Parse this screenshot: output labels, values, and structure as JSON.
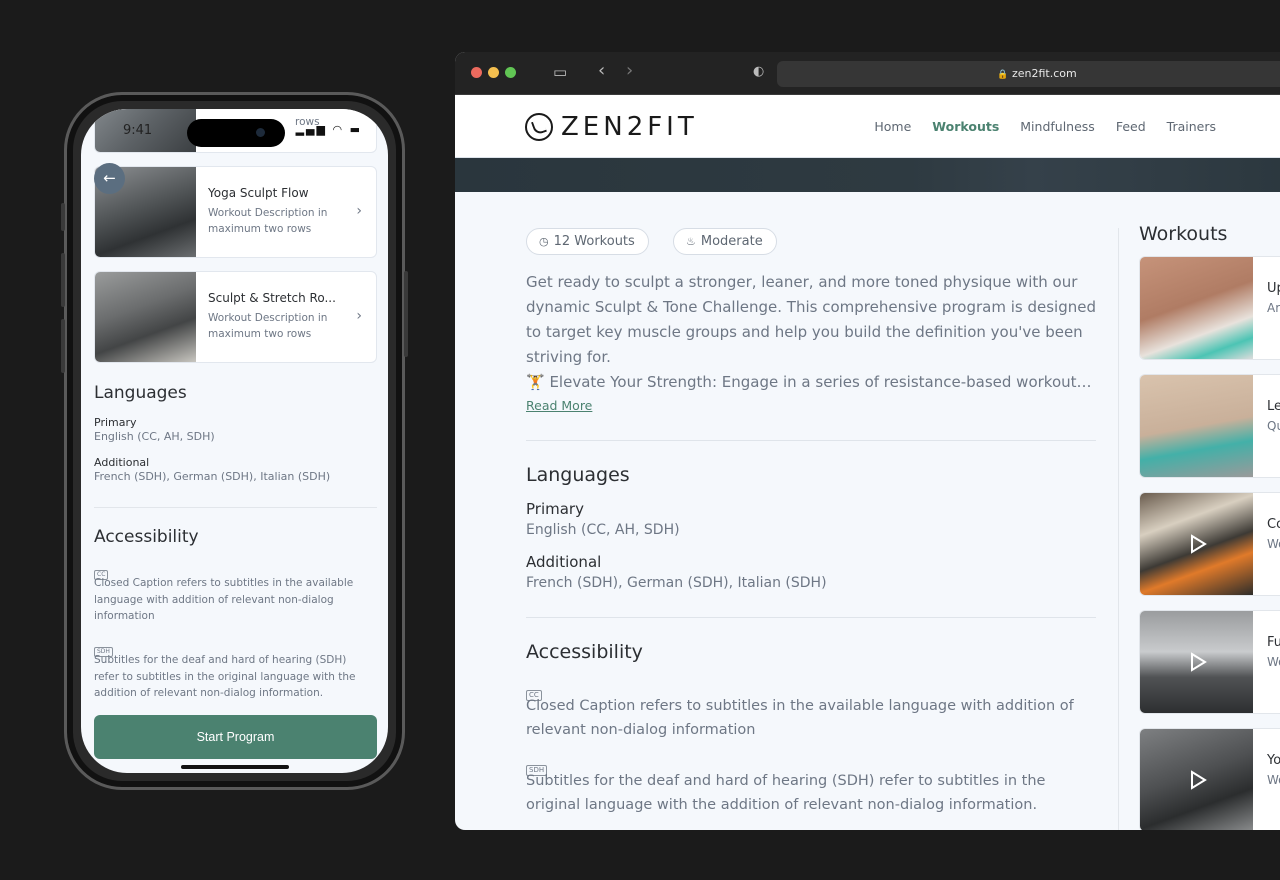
{
  "mobile": {
    "status": {
      "time": "9:41",
      "signal_icon": "signal-icon",
      "wifi_icon": "wifi-icon",
      "battery_icon": "battery-icon"
    },
    "partial_card": {
      "desc_tail": "rows"
    },
    "workout_cards": [
      {
        "title": "Yoga Sculpt Flow",
        "desc": "Workout Description in maximum two rows"
      },
      {
        "title": "Sculpt & Stretch Ro...",
        "desc": "Workout Description in maximum two rows"
      }
    ],
    "back_label": "←",
    "chevron": "›",
    "languages": {
      "heading": "Languages",
      "primary_label": "Primary",
      "primary_value": "English (CC, AH, SDH)",
      "additional_label": "Additional",
      "additional_value": "French (SDH), German (SDH), Italian (SDH)"
    },
    "accessibility": {
      "heading": "Accessibility",
      "cc_badge": "CC",
      "cc_text": "Closed Caption refers to subtitles in the available language with addition of relevant non-dialog information",
      "sdh_badge": "SDH",
      "sdh_text": "Subtitles for the deaf and hard of hearing (SDH) refer to subtitles in the original language with the addition of relevant non-dialog information."
    },
    "start_button": "Start Program"
  },
  "browser": {
    "url": "zen2fit.com",
    "lock_icon": "🔒",
    "brand": "ZEN2FIT",
    "nav": [
      {
        "label": "Home",
        "active": false
      },
      {
        "label": "Workouts",
        "active": true
      },
      {
        "label": "Mindfulness",
        "active": false
      },
      {
        "label": "Feed",
        "active": false
      },
      {
        "label": "Trainers",
        "active": false
      }
    ],
    "pills": {
      "workouts": "12 Workouts",
      "intensity": "Moderate"
    },
    "description": "Get ready to sculpt a stronger, leaner, and more toned physique with our dynamic Sculpt & Tone Challenge. This comprehensive program is designed to target key muscle groups and help you build the definition you've been striving for.",
    "description_line2": "🏋️ Elevate Your Strength: Engage in a series of resistance-based workouts designed to build muscle",
    "read_more": "Read More",
    "languages": {
      "heading": "Languages",
      "primary_label": "Primary",
      "primary_value": "English (CC, AH, SDH)",
      "additional_label": "Additional",
      "additional_value": "French (SDH), German (SDH), Italian (SDH)"
    },
    "accessibility": {
      "heading": "Accessibility",
      "cc_badge": "CC",
      "cc_text": "Closed Caption refers to subtitles in the available language with addition of relevant non-dialog information",
      "sdh_badge": "SDH",
      "sdh_text": "Subtitles for the deaf and hard of hearing (SDH) refer to subtitles in the original language with the addition of relevant non-dialog information."
    },
    "sidebar": {
      "title": "Workouts",
      "items": [
        {
          "title": "Up",
          "sub": "Ar"
        },
        {
          "title": "Le",
          "sub": "Qu"
        },
        {
          "title": "Co",
          "sub": "Wo"
        },
        {
          "title": "Fu",
          "sub": "Wo"
        },
        {
          "title": "Yo",
          "sub": "Wo"
        }
      ]
    }
  },
  "colors": {
    "accent": "#4b8270",
    "text": "#2c2f33",
    "muted": "#6e7785",
    "page_bg": "#f5f8fc",
    "backdrop": "#1b1b1b"
  }
}
